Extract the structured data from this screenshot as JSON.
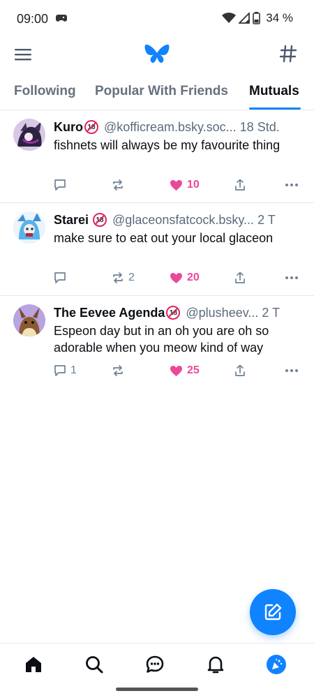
{
  "status_bar": {
    "time": "09:00",
    "battery": "34 %"
  },
  "tabs": [
    {
      "label": "Following",
      "active": false
    },
    {
      "label": "Popular With Friends",
      "active": false
    },
    {
      "label": "Mutuals",
      "active": true
    }
  ],
  "posts": [
    {
      "author": "Kuro",
      "badge": "18",
      "handle": "@kofficream.bsky.soc...",
      "time": "18 Std.",
      "text": "fishnets will always be my favourite thing",
      "replies": "",
      "reposts": "",
      "likes": "10"
    },
    {
      "author": "Starei",
      "badge": "18",
      "handle": "@glaceonsfatcock.bsky...",
      "time": "2 T",
      "text": "make sure to eat out your local glaceon",
      "replies": "",
      "reposts": "2",
      "likes": "20"
    },
    {
      "author": "The Eevee Agenda",
      "badge": "18",
      "handle": "@plusheev...",
      "time": "2 T",
      "text": "Espeon day but in an oh you are oh so adorable when you meow kind of way",
      "replies": "1",
      "reposts": "",
      "likes": "25"
    }
  ],
  "colors": {
    "accent": "#1083fe",
    "like": "#ec4899",
    "muted": "#6f8094"
  },
  "icons": {
    "menu": "hamburger-icon",
    "logo": "butterfly-icon",
    "feeds": "hash-icon",
    "reply": "speech-bubble-icon",
    "repost": "repost-icon",
    "like": "heart-icon",
    "share": "share-icon",
    "more": "ellipsis-icon",
    "compose": "compose-icon",
    "home": "home-icon",
    "search": "search-icon",
    "chat": "chat-icon",
    "notifications": "bell-icon",
    "profile": "avatar"
  }
}
